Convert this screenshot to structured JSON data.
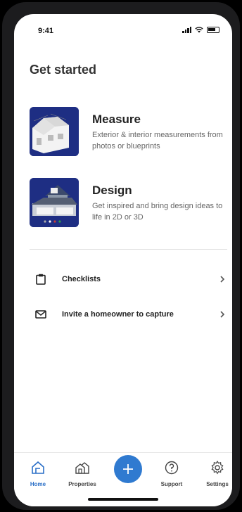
{
  "status": {
    "time": "9:41"
  },
  "header": {
    "title": "Get started"
  },
  "cards": [
    {
      "title": "Measure",
      "description": "Exterior & interior measurements from photos or blueprints"
    },
    {
      "title": "Design",
      "description": "Get inspired and bring design ideas to life in 2D or 3D"
    }
  ],
  "rows": [
    {
      "label": "Checklists",
      "icon": "clipboard-icon"
    },
    {
      "label": "Invite a homeowner to capture",
      "icon": "envelope-icon"
    }
  ],
  "tabbar": {
    "tabs": [
      {
        "label": "Home",
        "icon": "home-icon",
        "active": true
      },
      {
        "label": "Properties",
        "icon": "properties-icon"
      },
      {
        "label": "Support",
        "icon": "help-icon"
      },
      {
        "label": "Settings",
        "icon": "gear-icon"
      }
    ],
    "fab_icon": "plus-icon"
  },
  "colors": {
    "accent": "#2f7ad0",
    "thumb_bg": "#1e2e83"
  }
}
